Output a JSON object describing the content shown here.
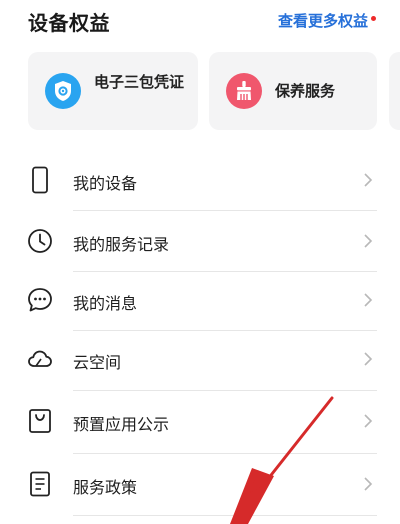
{
  "header": {
    "title": "设备权益",
    "more_link": "查看更多权益",
    "accent_color": "#2670d9",
    "dot_color": "#ee2a2a"
  },
  "cards": [
    {
      "label": "电子三包凭证",
      "icon": "shield-icon",
      "color": "#29a4f0"
    },
    {
      "label": "保养服务",
      "icon": "brush-icon",
      "color": "#f0576d"
    }
  ],
  "menu": {
    "items": [
      {
        "label": "我的设备",
        "icon": "phone-icon"
      },
      {
        "label": "我的服务记录",
        "icon": "clock-icon"
      },
      {
        "label": "我的消息",
        "icon": "chat-bubble-icon"
      },
      {
        "label": "云空间",
        "icon": "cloud-icon"
      },
      {
        "label": "预置应用公示",
        "icon": "shopping-bag-icon"
      },
      {
        "label": "服务政策",
        "icon": "document-icon"
      }
    ]
  },
  "annotation": {
    "type": "red-arrow",
    "color": "#d62a2a"
  }
}
